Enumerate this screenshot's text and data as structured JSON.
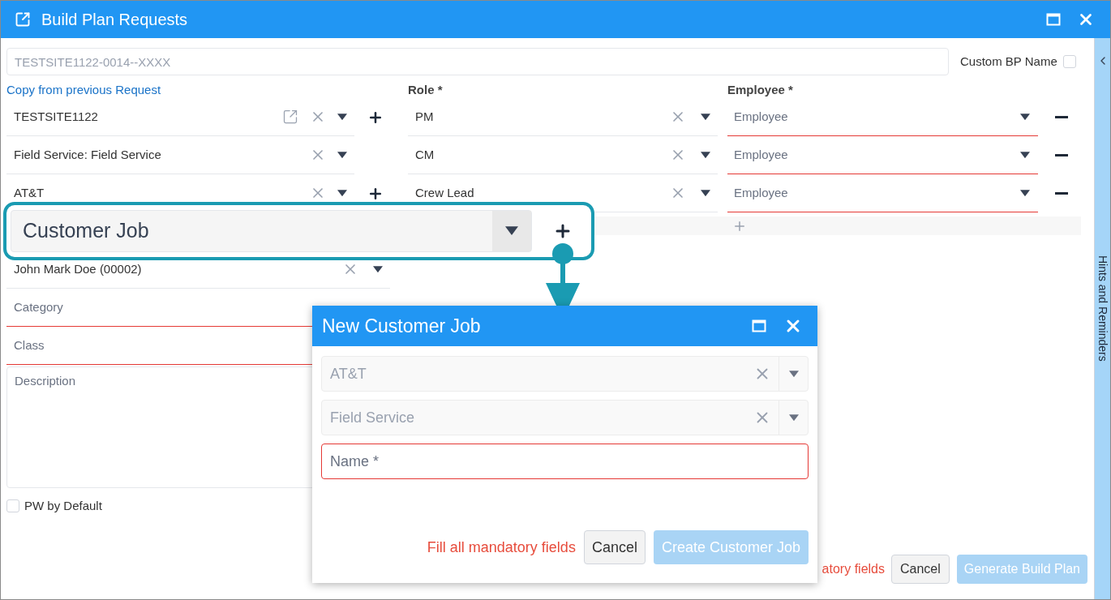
{
  "window": {
    "title": "Build Plan Requests"
  },
  "bp_name": {
    "value": "TESTSITE1122-0014--XXXX",
    "disabled": true
  },
  "custom_bp_name": {
    "label": "Custom BP Name",
    "checked": false
  },
  "copy_link": "Copy from previous Request",
  "site_fields": [
    {
      "value": "TESTSITE1122",
      "has_link": true,
      "has_add": true
    },
    {
      "value": "Field Service: Field Service",
      "has_link": false,
      "has_add": false
    },
    {
      "value": "AT&T",
      "has_link": false,
      "has_add": true
    }
  ],
  "assignments": {
    "role_header": "Role *",
    "employee_header": "Employee *",
    "rows": [
      {
        "role": "PM",
        "employee_placeholder": "Employee",
        "invalid": true
      },
      {
        "role": "CM",
        "employee_placeholder": "Employee",
        "invalid": true
      },
      {
        "role": "Crew Lead",
        "employee_placeholder": "Employee",
        "invalid": true
      }
    ]
  },
  "callout": {
    "value": "Customer Job"
  },
  "contact_field": {
    "value": "John Mark Doe (00002)"
  },
  "category": {
    "placeholder": "Category",
    "invalid": true
  },
  "class_field": {
    "placeholder": "Class",
    "invalid": true
  },
  "description": {
    "placeholder": "Description"
  },
  "pw_default": {
    "label": "PW by Default",
    "checked": false
  },
  "footer": {
    "message": "atory fields",
    "cancel": "Cancel",
    "submit": {
      "label": "Generate Build Plan",
      "disabled": true
    }
  },
  "sidebar": {
    "label": "Hints and Reminders"
  },
  "dialog": {
    "title": "New Customer Job",
    "fields": [
      {
        "value": "AT&T",
        "disabled": true
      },
      {
        "value": "Field Service",
        "disabled": true
      }
    ],
    "name": {
      "placeholder": "Name *",
      "invalid": true
    },
    "message": "Fill all mandatory fields",
    "cancel": "Cancel",
    "submit": {
      "label": "Create Customer Job",
      "disabled": true
    }
  }
}
